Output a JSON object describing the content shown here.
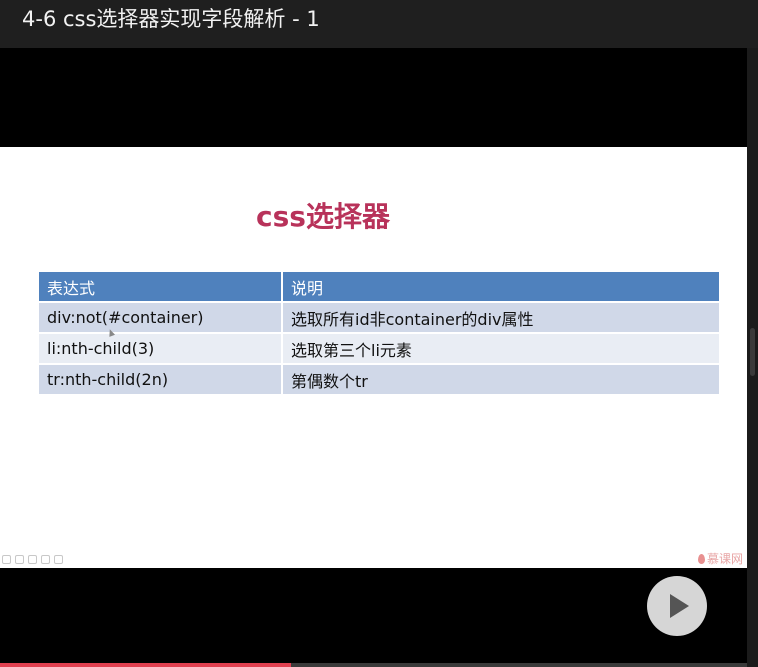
{
  "window": {
    "title": "4-6 css选择器实现字段解析 - 1"
  },
  "slide": {
    "title": "css选择器",
    "table": {
      "headers": [
        "表达式",
        "说明"
      ],
      "rows": [
        [
          "div:not(#container)",
          "选取所有id非container的div属性"
        ],
        [
          "li:nth-child(3)",
          "选取第三个li元素"
        ],
        [
          "tr:nth-child(2n)",
          "第偶数个tr"
        ]
      ]
    },
    "watermark": "慕课网",
    "title_color": "#b8325a",
    "header_color": "#4f81bd"
  },
  "player": {
    "play_icon": "play-icon",
    "progress": 0.39,
    "progress_color": "#e04050"
  }
}
